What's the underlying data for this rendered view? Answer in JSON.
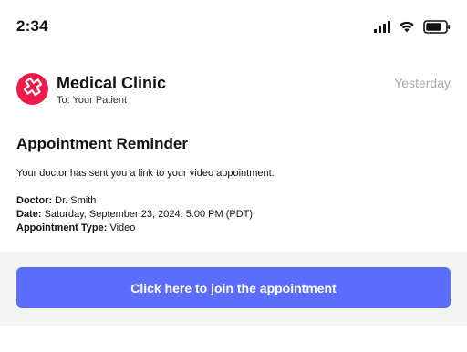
{
  "status_bar": {
    "time": "2:34",
    "icons": [
      "signal-icon",
      "wifi-icon",
      "battery-icon"
    ]
  },
  "email": {
    "sender": "Medical Clinic",
    "recipient": "To: Your Patient",
    "date": "Yesterday",
    "avatar_icon": "medical-cross-icon",
    "subject": "Appointment Reminder",
    "intro": "Your doctor has sent you a link to your video appointment.",
    "details": [
      {
        "label": "Doctor:",
        "value": "Dr. Smith"
      },
      {
        "label": "Date:",
        "value": "Saturday, September 23, 2024, 5:00 PM (PDT)"
      },
      {
        "label": "Appointment Type:",
        "value": "Video"
      }
    ],
    "button_label": "Click here to join the appointment"
  },
  "colors": {
    "accent": "#5c6cfc",
    "avatar": "#f0194c",
    "muted_text": "#a8a8a8",
    "footer_bg": "#f4f4f5"
  }
}
